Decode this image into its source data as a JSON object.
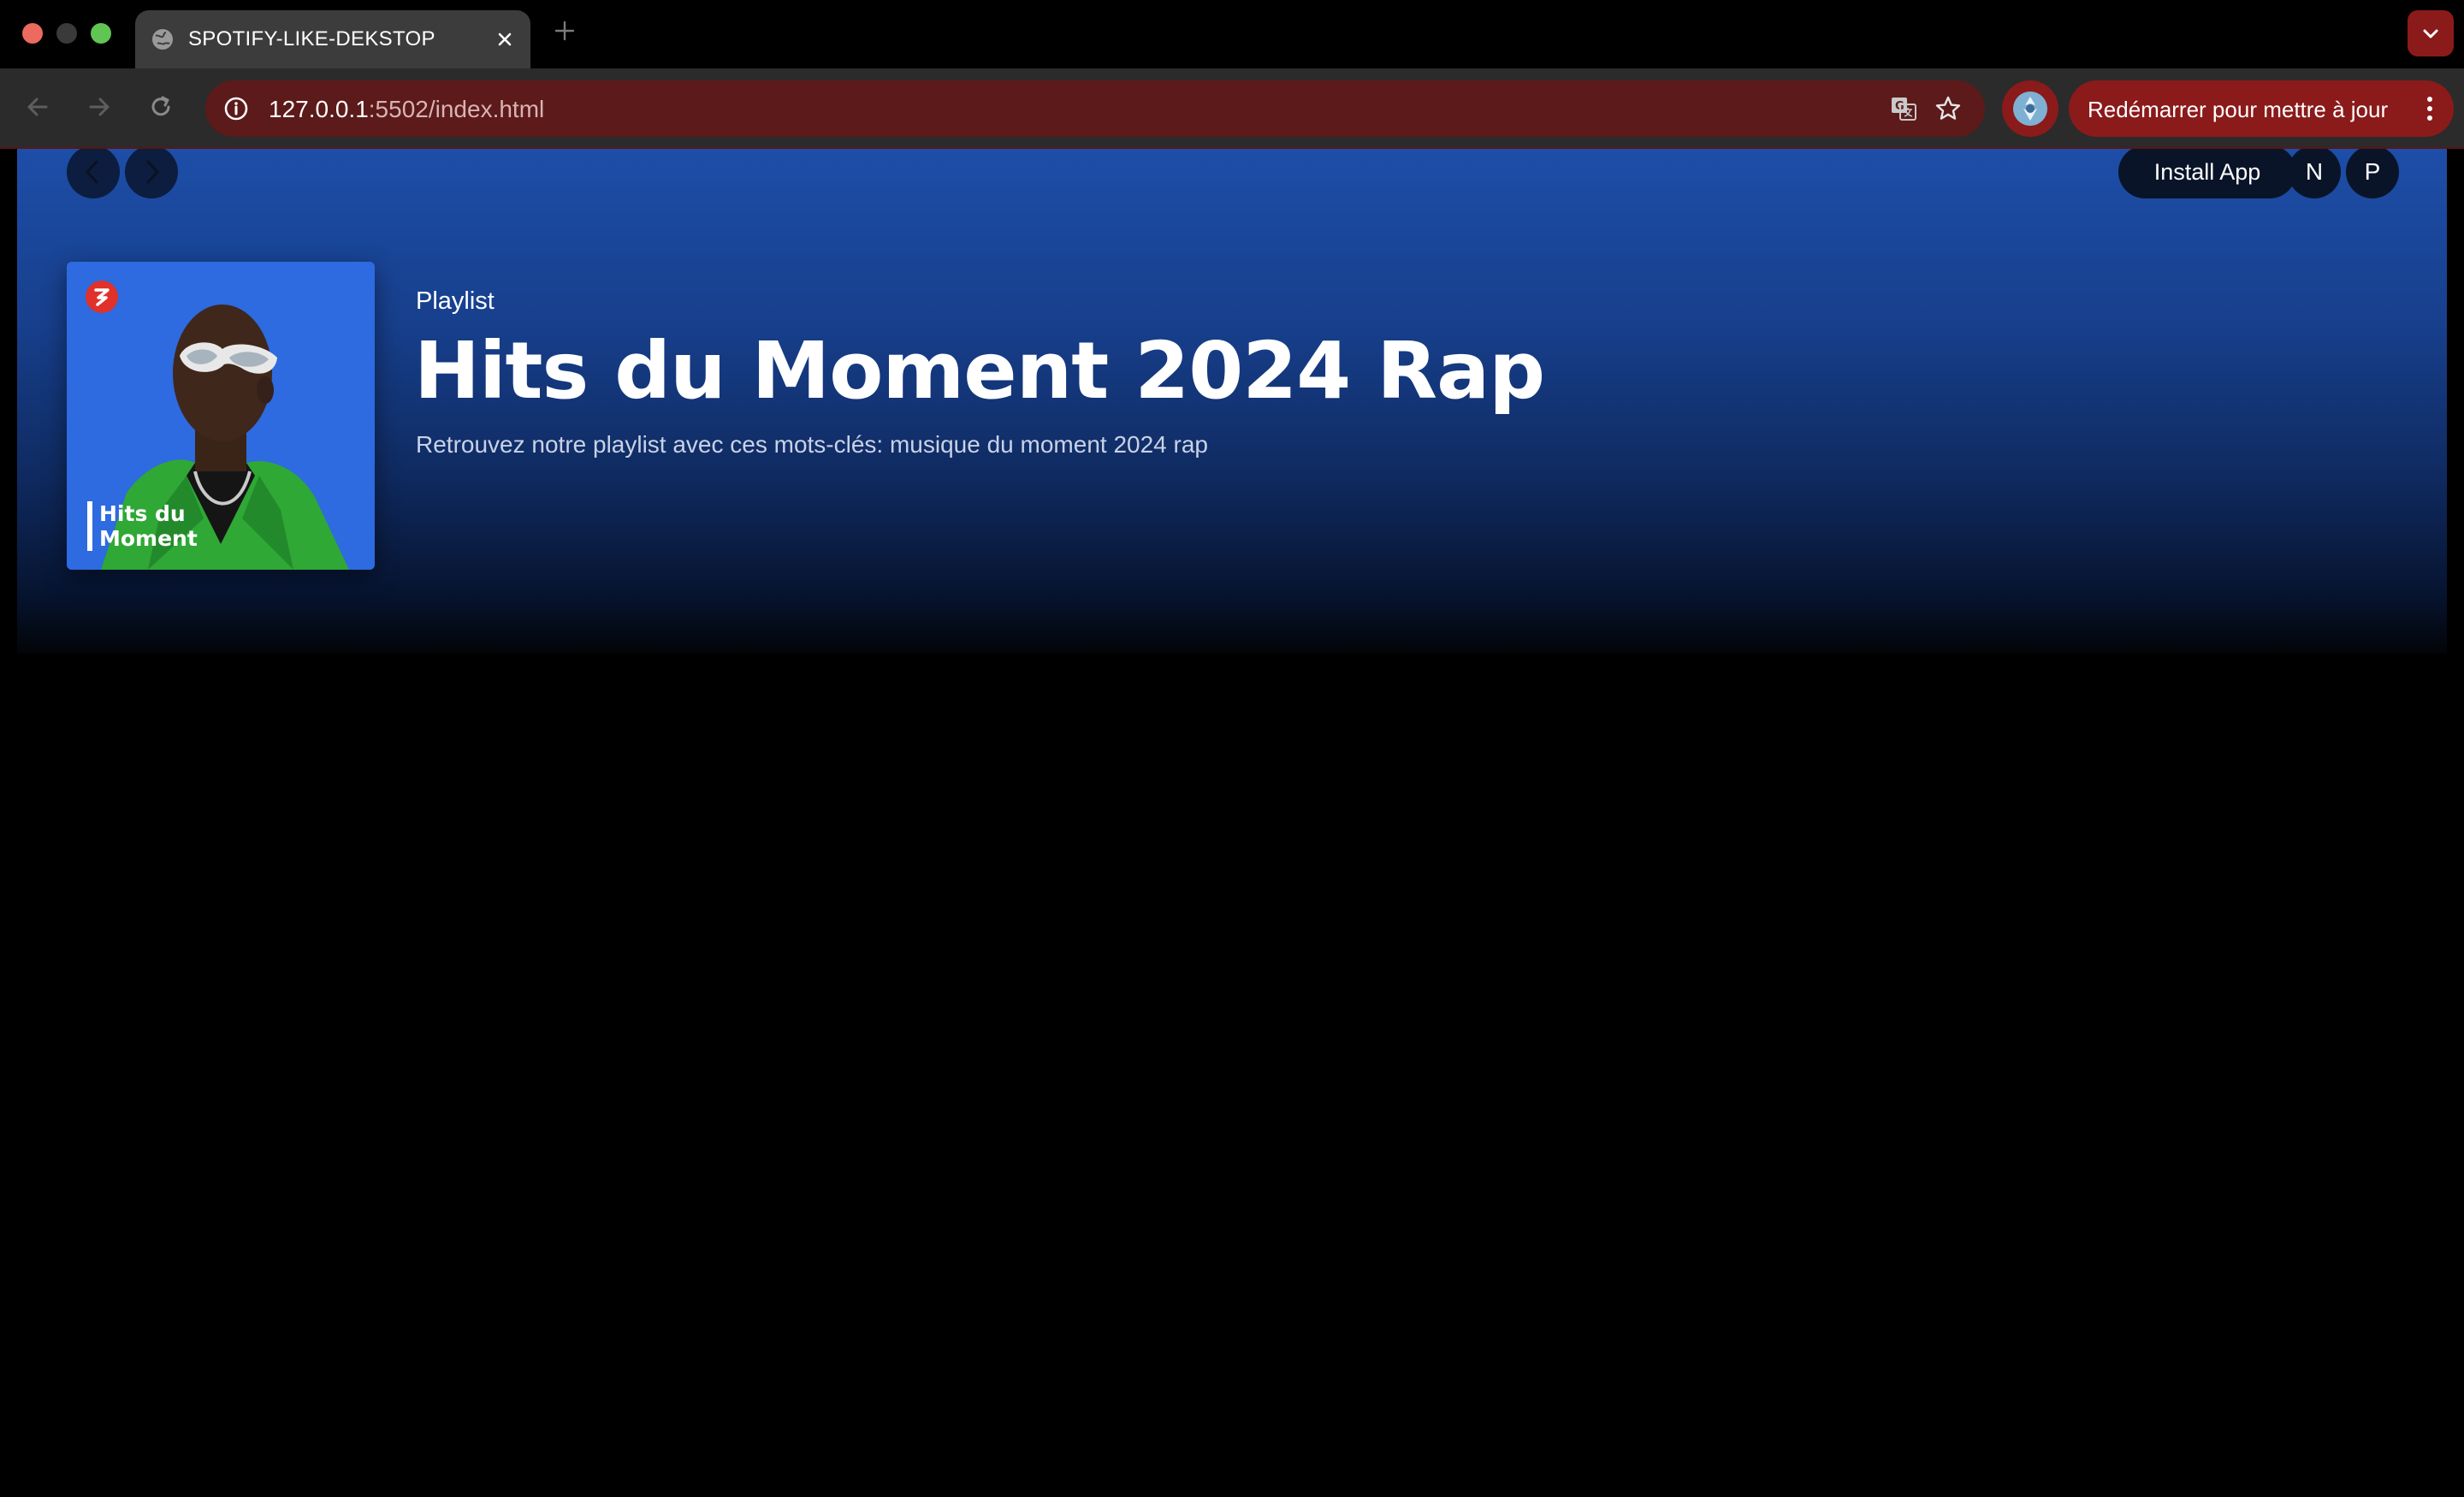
{
  "browser": {
    "tab": {
      "title": "SPOTIFY-LIKE-DEKSTOP",
      "favicon": "globe-icon"
    },
    "address_bar": {
      "host": "127.0.0.1",
      "path": ":5502/index.html"
    },
    "update_button": {
      "label": "Redémarrer pour mettre à jour"
    },
    "accent_color": "#8b1a1a"
  },
  "page": {
    "header": {
      "install_label": "Install App",
      "user_initials": [
        "N",
        "P"
      ]
    },
    "playlist": {
      "type": "Playlist",
      "title": "Hits du Moment 2024 Rap",
      "description": "Retrouvez notre playlist avec ces mots-clés: musique du moment 2024 rap",
      "cover_caption_line1": "Hits du",
      "cover_caption_line2": "Moment"
    },
    "hero_color": "#1d4ea8"
  }
}
